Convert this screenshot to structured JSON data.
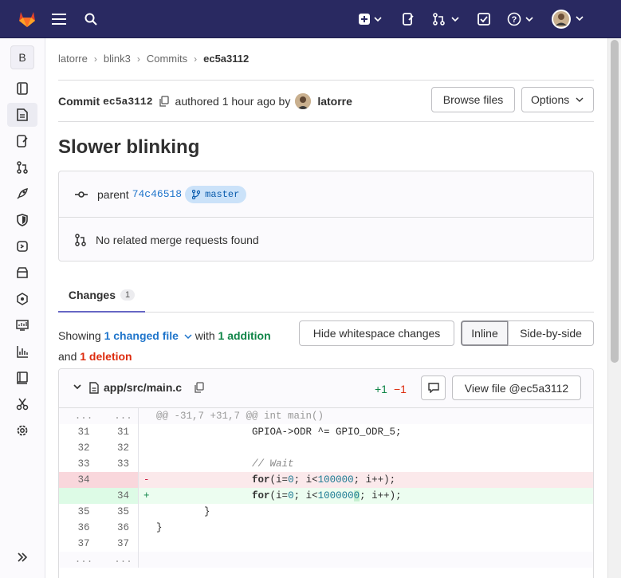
{
  "topbar": {
    "icons": [
      "gitlab-logo",
      "menu-icon",
      "search-icon",
      "create-new-icon",
      "chevron-down-icon",
      "issues-icon",
      "merge-requests-icon",
      "chevron-down-icon",
      "todos-icon",
      "help-icon",
      "chevron-down-icon",
      "user-avatar",
      "chevron-down-icon"
    ]
  },
  "sidebar": {
    "project_letter": "B",
    "items": [
      {
        "icon": "project-overview-icon"
      },
      {
        "icon": "repository-icon",
        "active": true
      },
      {
        "icon": "issues-icon"
      },
      {
        "icon": "merge-requests-icon"
      },
      {
        "icon": "rocket-icon"
      },
      {
        "icon": "shield-icon"
      },
      {
        "icon": "deployments-icon"
      },
      {
        "icon": "packages-icon"
      },
      {
        "icon": "monitor-icon"
      },
      {
        "icon": "infrastructure-icon"
      },
      {
        "icon": "analytics-icon"
      },
      {
        "icon": "wiki-icon"
      },
      {
        "icon": "snippets-icon"
      },
      {
        "icon": "settings-icon"
      }
    ],
    "collapse_icon": "collapse-sidebar-icon"
  },
  "breadcrumb": [
    "latorre",
    "blink3",
    "Commits",
    "ec5a3112"
  ],
  "commit": {
    "label": "Commit",
    "sha": "ec5a3112",
    "authored": "authored 1 hour ago by",
    "author": "latorre",
    "browse_files": "Browse files",
    "options": "Options",
    "title": "Slower blinking",
    "parent_label": "parent",
    "parent_sha": "74c46518",
    "branch": "master",
    "no_mr": "No related merge requests found"
  },
  "tabs": {
    "changes_label": "Changes",
    "changes_count": "1"
  },
  "summary": {
    "showing": "Showing",
    "changed_files": "1 changed file",
    "with": "with",
    "additions": "1 addition",
    "and": "and",
    "deletions": "1 deletion",
    "hide_ws": "Hide whitespace changes",
    "inline": "Inline",
    "side_by_side": "Side-by-side"
  },
  "file": {
    "path": "app/src/main.c",
    "added": "+1",
    "removed": "−1",
    "view_file": "View file @ec5a3112"
  },
  "diff_lines": [
    {
      "type": "match",
      "old": "...",
      "new": "...",
      "marker": "",
      "text": "@@ -31,7 +31,7 @@ int main()"
    },
    {
      "type": "ctx",
      "old": "31",
      "new": "31",
      "marker": "",
      "text": "                GPIOA->ODR ^= GPIO_ODR_5;"
    },
    {
      "type": "ctx",
      "old": "32",
      "new": "32",
      "marker": "",
      "text": ""
    },
    {
      "type": "ctx",
      "old": "33",
      "new": "33",
      "marker": "",
      "text": "                // Wait"
    },
    {
      "type": "del",
      "old": "34",
      "new": "",
      "marker": "-",
      "text": "                for(i=0; i<100000; i++);"
    },
    {
      "type": "add",
      "old": "",
      "new": "34",
      "marker": "+",
      "text": "                for(i=0; i<1000000; i++);"
    },
    {
      "type": "ctx",
      "old": "35",
      "new": "35",
      "marker": "",
      "text": "        }"
    },
    {
      "type": "ctx",
      "old": "36",
      "new": "36",
      "marker": "",
      "text": "}"
    },
    {
      "type": "ctx",
      "old": "37",
      "new": "37",
      "marker": "",
      "text": ""
    },
    {
      "type": "match",
      "old": "...",
      "new": "...",
      "marker": "",
      "text": ""
    }
  ]
}
